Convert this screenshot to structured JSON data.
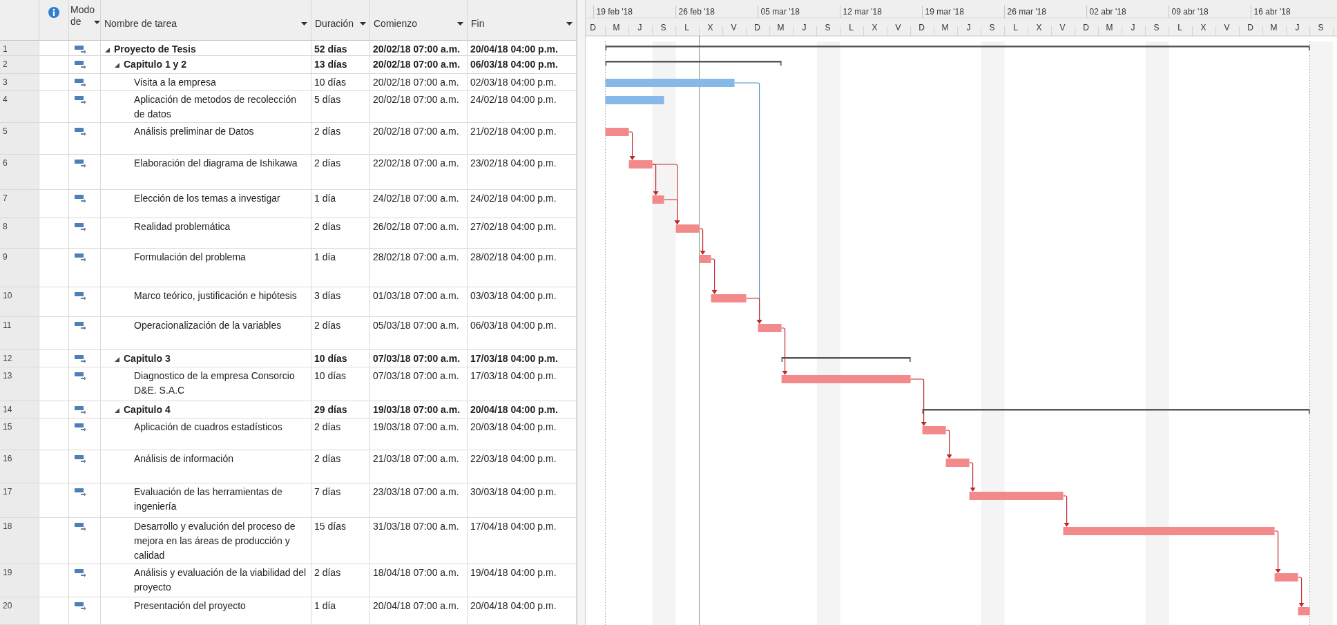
{
  "columns": [
    {
      "label": "Modo de"
    },
    {
      "label": "Nombre de tarea"
    },
    {
      "label": "Duración"
    },
    {
      "label": "Comienzo"
    },
    {
      "label": "Fin"
    }
  ],
  "timescale": {
    "weeks": [
      "19 feb '18",
      "26 feb '18",
      "05 mar '18",
      "12 mar '18",
      "19 mar '18",
      "26 mar '18",
      "02 abr '18",
      "09 abr '18",
      "16 abr '18"
    ],
    "days": [
      "D",
      "M",
      "J",
      "S",
      "L",
      "X",
      "V",
      "D",
      "M",
      "J",
      "S",
      "L",
      "X",
      "V",
      "D",
      "M",
      "J",
      "S",
      "L",
      "X",
      "V",
      "D",
      "M",
      "J",
      "S",
      "L",
      "X",
      "V",
      "D",
      "M",
      "J",
      "S"
    ]
  },
  "rows": [
    {
      "number": "1",
      "name": "Proyecto de Tesis",
      "duration": "52 días",
      "start": "20/02/18 07:00 a.m.",
      "finish": "20/04/18 04:00 p.m.",
      "kind": "summary",
      "expanded": true,
      "children": [
        {
          "number": "2",
          "name": "Capitulo 1 y 2",
          "duration": "13 días",
          "start": "20/02/18 07:00 a.m.",
          "finish": "06/03/18 04:00 p.m.",
          "kind": "summary",
          "expanded": true,
          "children": [
            {
              "number": "3",
              "name": "Visita a la empresa",
              "duration": "10 días",
              "start": "20/02/18 07:00 a.m.",
              "finish": "02/03/18 04:00 p.m.",
              "kind": "task",
              "critical": false
            },
            {
              "number": "4",
              "name": "Aplicación de metodos de recolección de datos",
              "duration": "5 días",
              "start": "20/02/18 07:00 a.m.",
              "finish": "24/02/18 04:00 p.m.",
              "kind": "task",
              "critical": false
            },
            {
              "number": "5",
              "name": "Análisis preliminar de Datos",
              "duration": "2 días",
              "start": "20/02/18 07:00 a.m.",
              "finish": "21/02/18 04:00 p.m.",
              "kind": "task",
              "critical": true
            },
            {
              "number": "6",
              "name": "Elaboración del diagrama de Ishikawa",
              "duration": "2 días",
              "start": "22/02/18 07:00 a.m.",
              "finish": "23/02/18 04:00 p.m.",
              "kind": "task",
              "critical": true
            },
            {
              "number": "7",
              "name": "Elección de los temas a investigar",
              "duration": "1 día",
              "start": "24/02/18 07:00 a.m.",
              "finish": "24/02/18 04:00 p.m.",
              "kind": "task",
              "critical": true
            },
            {
              "number": "8",
              "name": "Realidad problemática",
              "duration": "2 días",
              "start": "26/02/18 07:00 a.m.",
              "finish": "27/02/18 04:00 p.m.",
              "kind": "task",
              "critical": true
            },
            {
              "number": "9",
              "name": "Formulación del problema",
              "duration": "1 día",
              "start": "28/02/18 07:00 a.m.",
              "finish": "28/02/18 04:00 p.m.",
              "kind": "task",
              "critical": true
            },
            {
              "number": "10",
              "name": "Marco teórico, justificación e hipótesis",
              "duration": "3 días",
              "start": "01/03/18 07:00 a.m.",
              "finish": "03/03/18 04:00 p.m.",
              "kind": "task",
              "critical": true
            },
            {
              "number": "11",
              "name": "Operacionalización de la variables",
              "duration": "2 días",
              "start": "05/03/18 07:00 a.m.",
              "finish": "06/03/18 04:00 p.m.",
              "kind": "task",
              "critical": true
            }
          ]
        },
        {
          "number": "12",
          "name": "Capitulo 3",
          "duration": "10 días",
          "start": "07/03/18 07:00 a.m.",
          "finish": "17/03/18 04:00 p.m.",
          "kind": "summary",
          "expanded": true,
          "children": [
            {
              "number": "13",
              "name": "Diagnostico de la empresa Consorcio D&E. S.A.C",
              "duration": "10 días",
              "start": "07/03/18 07:00 a.m.",
              "finish": "17/03/18 04:00 p.m.",
              "kind": "task",
              "critical": true
            }
          ]
        },
        {
          "number": "14",
          "name": "Capitulo 4",
          "duration": "29 días",
          "start": "19/03/18 07:00 a.m.",
          "finish": "20/04/18 04:00 p.m.",
          "kind": "summary",
          "expanded": true,
          "children": [
            {
              "number": "15",
              "name": "Aplicación de cuadros estadísticos",
              "duration": "2 días",
              "start": "19/03/18 07:00 a.m.",
              "finish": "20/03/18 04:00 p.m.",
              "kind": "task",
              "critical": true
            },
            {
              "number": "16",
              "name": "Análisis de información",
              "duration": "2 días",
              "start": "21/03/18 07:00 a.m.",
              "finish": "22/03/18 04:00 p.m.",
              "kind": "task",
              "critical": true
            },
            {
              "number": "17",
              "name": "Evaluación de las herramientas de ingeniería",
              "duration": "7 días",
              "start": "23/03/18 07:00 a.m.",
              "finish": "30/03/18 04:00 p.m.",
              "kind": "task",
              "critical": true
            },
            {
              "number": "18",
              "name": "Desarrollo y evalución del proceso de mejora en las áreas de producción y calidad",
              "duration": "15 días",
              "start": "31/03/18 07:00 a.m.",
              "finish": "17/04/18 04:00 p.m.",
              "kind": "task",
              "critical": true
            },
            {
              "number": "19",
              "name": "Análisis y evaluación de la viabilidad del proyecto",
              "duration": "2 días",
              "start": "18/04/18 07:00 a.m.",
              "finish": "19/04/18 04:00 p.m.",
              "kind": "task",
              "critical": true
            },
            {
              "number": "20",
              "name": "Presentación del proyecto",
              "duration": "1 día",
              "start": "20/04/18 07:00 a.m.",
              "finish": "20/04/18 04:00 p.m.",
              "kind": "task",
              "critical": true
            }
          ]
        }
      ]
    }
  ]
}
